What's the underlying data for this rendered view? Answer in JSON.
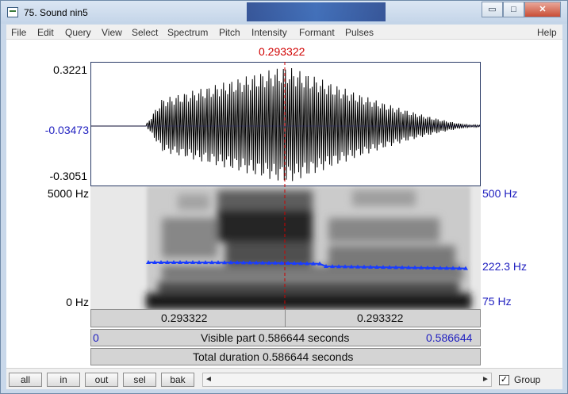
{
  "window": {
    "title": "75. Sound nin5",
    "min_label": "▭",
    "max_label": "□",
    "close_label": "✕"
  },
  "menu": [
    "File",
    "Edit",
    "Query",
    "View",
    "Select",
    "Spectrum",
    "Pitch",
    "Intensity",
    "Formant",
    "Pulses",
    "Help"
  ],
  "cursor_time": "0.293322",
  "waveform": {
    "y_top": "0.3221",
    "y_mid": "-0.03473",
    "y_bottom": "-0.3051"
  },
  "spectrogram": {
    "freq_top": "5000 Hz",
    "freq_bottom": "0 Hz",
    "pitch_top": "500 Hz",
    "pitch_current": "222.3 Hz",
    "pitch_bottom": "75 Hz"
  },
  "selection_bar": {
    "left": "0.293322",
    "right": "0.293322"
  },
  "visible_bar": {
    "start": "0",
    "text": "Visible part 0.586644 seconds",
    "end": "0.586644"
  },
  "total_bar": {
    "text": "Total duration 0.586644 seconds"
  },
  "buttons": {
    "all": "all",
    "in": "in",
    "out": "out",
    "sel": "sel",
    "bak": "bak"
  },
  "scroll": {
    "left_arrow": "◄",
    "right_arrow": "►"
  },
  "group": {
    "checked_mark": "✓",
    "label": "Group"
  },
  "colors": {
    "cursor": "#d00000",
    "pitch": "#1a3cff",
    "axis_blue": "#2020c0"
  }
}
